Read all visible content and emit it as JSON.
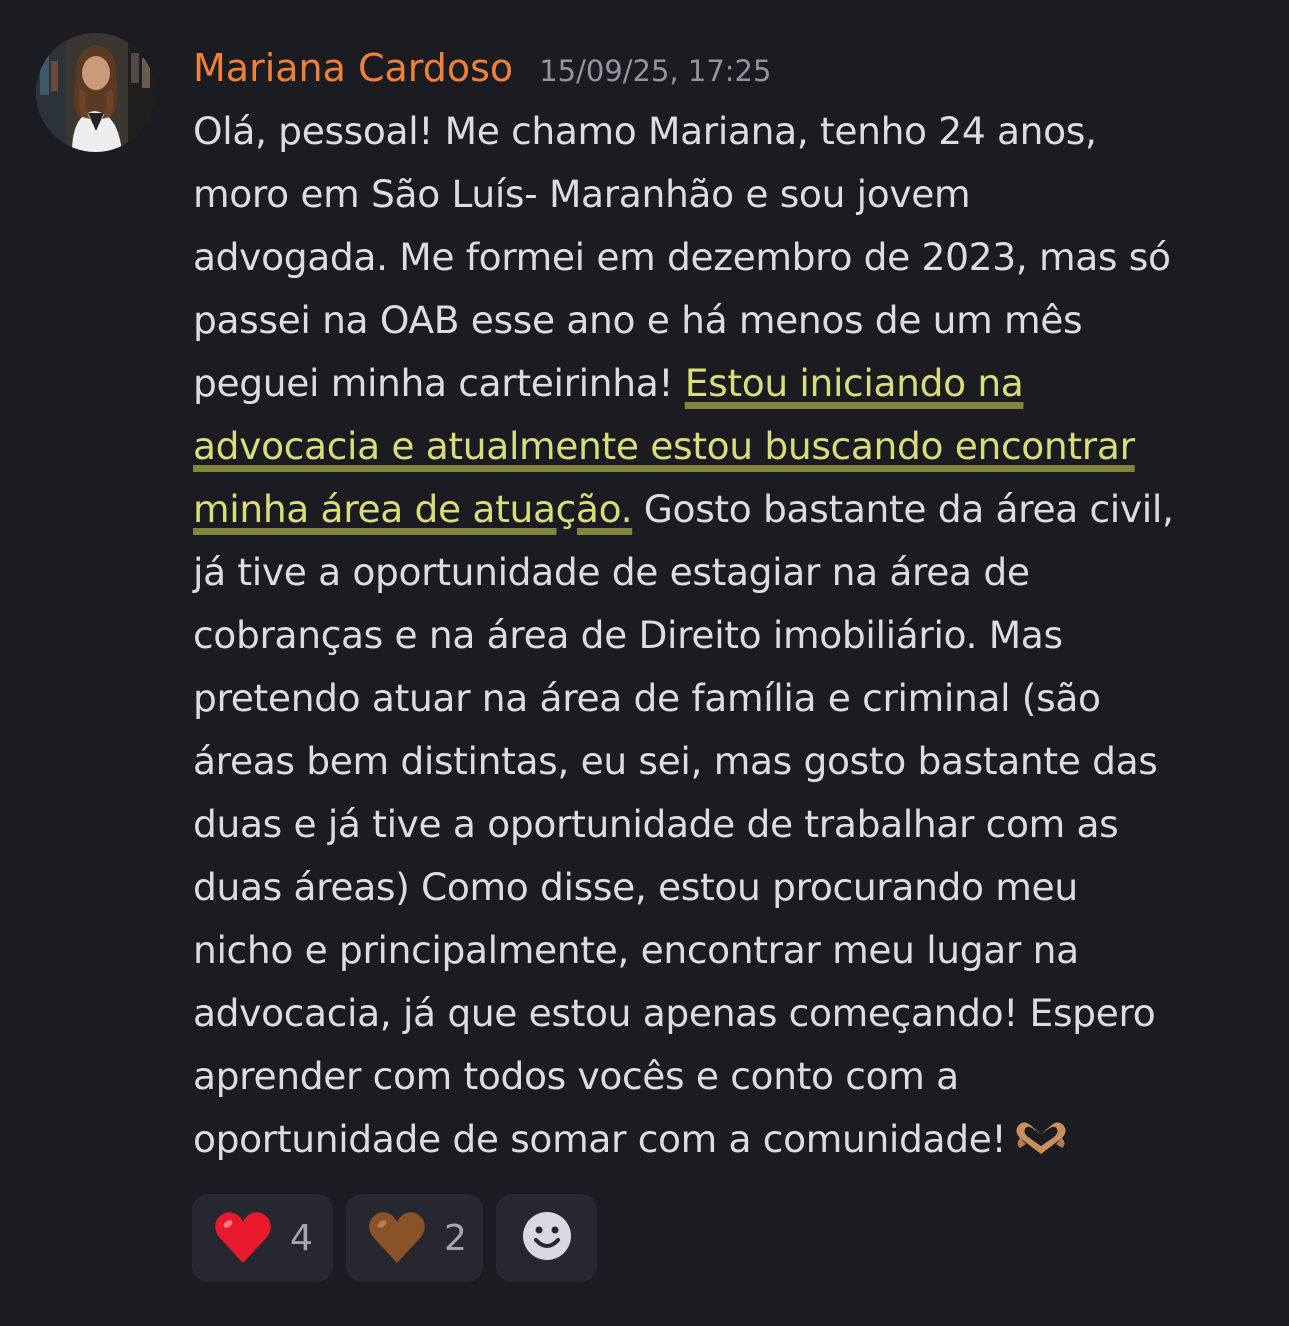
{
  "message": {
    "author": "Mariana Cardoso",
    "timestamp": "15/09/25, 17:25",
    "author_color": "#f0803a",
    "highlight_color": "#d9dd7a",
    "lines": [
      [
        "Olá, pessoal! Me chamo Mariana, tenho 24 anos,"
      ],
      [
        "moro em São Luís- Maranhão e sou jovem"
      ],
      [
        "advogada. Me formei em dezembro de 2023, mas só"
      ],
      [
        "passei na OAB esse ano e há menos de um mês"
      ],
      [
        "peguei minha carteirinha! ",
        "Estou iniciando na"
      ],
      [
        "advocacia e atualmente estou buscando encontrar"
      ],
      [
        "minha área de atuação.",
        " Gosto bastante da área civil,"
      ],
      [
        "já tive a oportunidade de estagiar na área de"
      ],
      [
        "cobranças e na área de Direito imobiliário. Mas"
      ],
      [
        "pretendo atuar na área de família e criminal (são"
      ],
      [
        "áreas bem distintas, eu sei, mas gosto bastante das"
      ],
      [
        "duas e já tive a oportunidade de trabalhar com as"
      ],
      [
        "duas áreas) Como disse, estou procurando meu"
      ],
      [
        "nicho e principalmente, encontrar meu lugar na"
      ],
      [
        "advocacia, já que estou apenas começando! Espero"
      ],
      [
        "aprender com todos vocês e conto com a"
      ],
      [
        "oportunidade de somar com a comunidade!"
      ]
    ],
    "trailing_emoji": "heart-hands-icon"
  },
  "reactions": [
    {
      "emoji": "red-heart-icon",
      "count": "4"
    },
    {
      "emoji": "brown-heart-icon",
      "count": "2"
    }
  ],
  "add_reaction_icon": "add-reaction-smiley-icon"
}
